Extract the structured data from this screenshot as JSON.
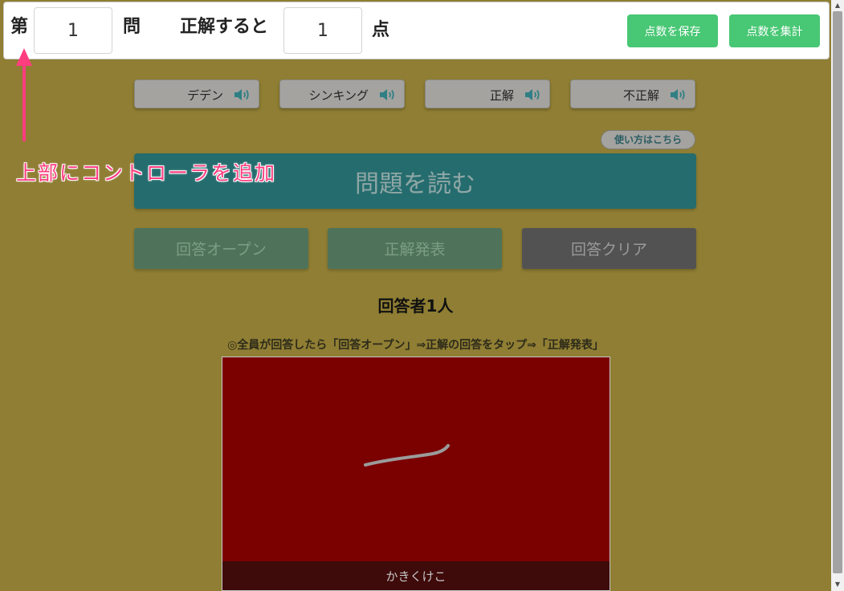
{
  "topbar": {
    "dai_label": "第",
    "question_number": "1",
    "mon_label": "問",
    "correct_label": "正解すると",
    "points_value": "1",
    "ten_label": "点",
    "save_button": "点数を保存",
    "tally_button": "点数を集計"
  },
  "sounds": [
    {
      "label": "デデン",
      "icon": "speaker-icon"
    },
    {
      "label": "シンキング",
      "icon": "speaker-icon"
    },
    {
      "label": "正解",
      "icon": "speaker-icon"
    },
    {
      "label": "不正解",
      "icon": "speaker-icon"
    }
  ],
  "help_link": "使い方はこちら",
  "read_button": "問題を読む",
  "controls": {
    "open": "回答オープン",
    "reveal": "正解発表",
    "clear": "回答クリア"
  },
  "respondents_title": "回答者1人",
  "instructions": "◎全員が回答したら「回答オープン」⇒正解の回答をタップ⇒「正解発表」",
  "answers": [
    {
      "name": "かきくけこ",
      "handwriting": "ー"
    }
  ],
  "annotation": "上部にコントローラを追加",
  "colors": {
    "background": "#8f7e33",
    "accent_green": "#48c774",
    "teal": "#256c6e",
    "answer_bg": "#7b0000",
    "annotation": "#ff3d7f"
  }
}
